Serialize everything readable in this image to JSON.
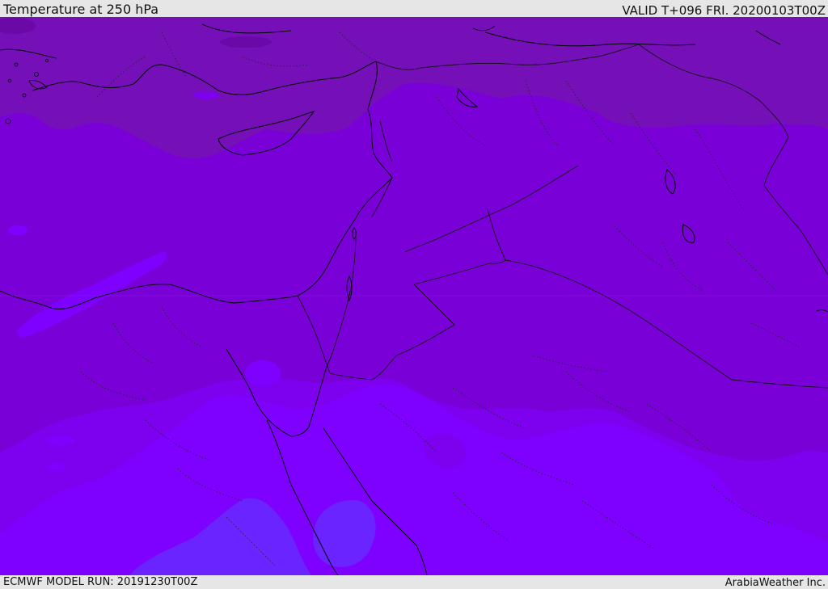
{
  "header": {
    "title": "Temperature at 250 hPa",
    "valid_time": "VALID T+096 FRI. 20200103T00Z"
  },
  "footer": {
    "model_run": "ECMWF MODEL RUN: 20191230T00Z",
    "credit": "ArabiaWeather Inc."
  },
  "map": {
    "colors": {
      "warmest_band": "#7510b8",
      "warm_band": "#7a00d8",
      "mid_band": "#7d00ef",
      "cool_band": "#7e00ff",
      "coldest_band": "#6a24ff",
      "darkest_patch": "#6a08a8",
      "water_coast": "#000000",
      "borders": "#222222"
    }
  }
}
